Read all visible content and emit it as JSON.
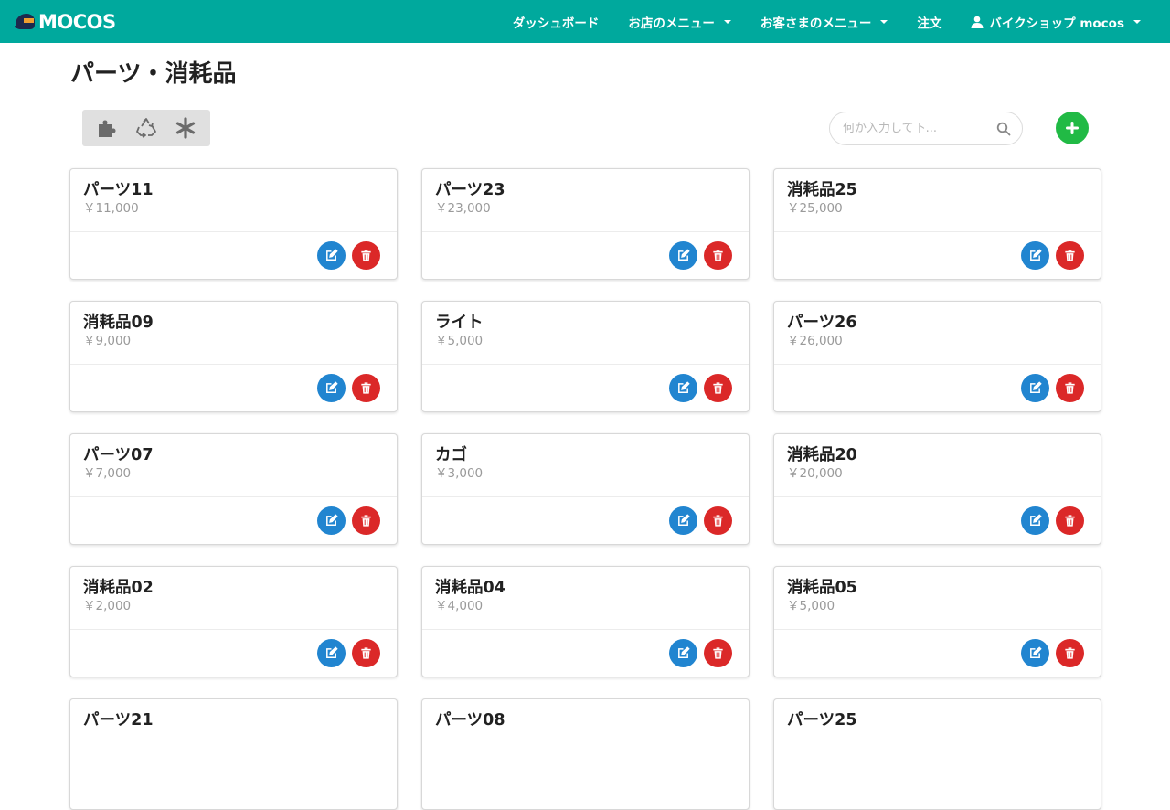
{
  "navbar": {
    "brand": "MOCOS",
    "items": [
      {
        "label": "ダッシュボード",
        "dropdown": false
      },
      {
        "label": "お店のメニュー",
        "dropdown": true
      },
      {
        "label": "お客さまのメニュー",
        "dropdown": true
      },
      {
        "label": "注文",
        "dropdown": false
      }
    ],
    "user": {
      "label": "バイクショップ mocos",
      "dropdown": true
    }
  },
  "page": {
    "title": "パーツ・消耗品"
  },
  "filters": [
    {
      "icon": "puzzle-icon",
      "name": "parts"
    },
    {
      "icon": "recycle-icon",
      "name": "consumables"
    },
    {
      "icon": "asterisk-icon",
      "name": "all"
    }
  ],
  "search": {
    "placeholder": "何か入力して下...",
    "value": ""
  },
  "colors": {
    "navbar": "#00a99d",
    "add": "#21ba45",
    "edit": "#2185d0",
    "delete": "#db2828"
  },
  "items": [
    {
      "name": "パーツ11",
      "price": "￥11,000"
    },
    {
      "name": "パーツ23",
      "price": "￥23,000"
    },
    {
      "name": "消耗品25",
      "price": "￥25,000"
    },
    {
      "name": "消耗品09",
      "price": "￥9,000"
    },
    {
      "name": "ライト",
      "price": "￥5,000"
    },
    {
      "name": "パーツ26",
      "price": "￥26,000"
    },
    {
      "name": "パーツ07",
      "price": "￥7,000"
    },
    {
      "name": "カゴ",
      "price": "￥3,000"
    },
    {
      "name": "消耗品20",
      "price": "￥20,000"
    },
    {
      "name": "消耗品02",
      "price": "￥2,000"
    },
    {
      "name": "消耗品04",
      "price": "￥4,000"
    },
    {
      "name": "消耗品05",
      "price": "￥5,000"
    },
    {
      "name": "パーツ21",
      "price": ""
    },
    {
      "name": "パーツ08",
      "price": ""
    },
    {
      "name": "パーツ25",
      "price": ""
    }
  ]
}
